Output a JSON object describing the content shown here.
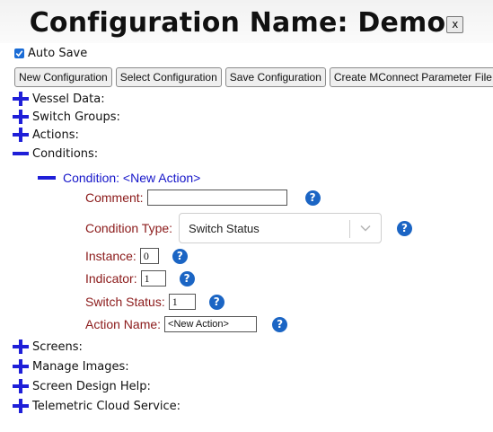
{
  "header": {
    "title": "Configuration Name: Demo",
    "close_label": "x"
  },
  "autosave": {
    "label": "Auto Save",
    "checked": true
  },
  "toolbar": {
    "new_label": "New Configuration",
    "select_label": "Select Configuration",
    "save_label": "Save Configuration",
    "mconnect_label": "Create MConnect Parameter File"
  },
  "tree": {
    "vessel_data": "Vessel Data:",
    "switch_groups": "Switch Groups:",
    "actions": "Actions:",
    "conditions": "Conditions:",
    "screens": "Screens:",
    "manage_images": "Manage Images:",
    "screen_design_help": "Screen Design Help:",
    "telemetric_cloud": "Telemetric Cloud Service:"
  },
  "condition": {
    "header": "Condition: <New Action>",
    "comment_label": "Comment:",
    "comment_value": "",
    "type_label": "Condition Type:",
    "type_value": "Switch Status",
    "instance_label": "Instance:",
    "instance_value": "0",
    "indicator_label": "Indicator:",
    "indicator_value": "1",
    "switch_status_label": "Switch Status:",
    "switch_status_value": "1",
    "action_name_label": "Action Name:",
    "action_name_value": "<New Action>"
  },
  "colors": {
    "expander": "#1f1fd8",
    "label": "#8b1a1a",
    "condition_header": "#1515c9",
    "help_icon": "#1b65c4"
  }
}
